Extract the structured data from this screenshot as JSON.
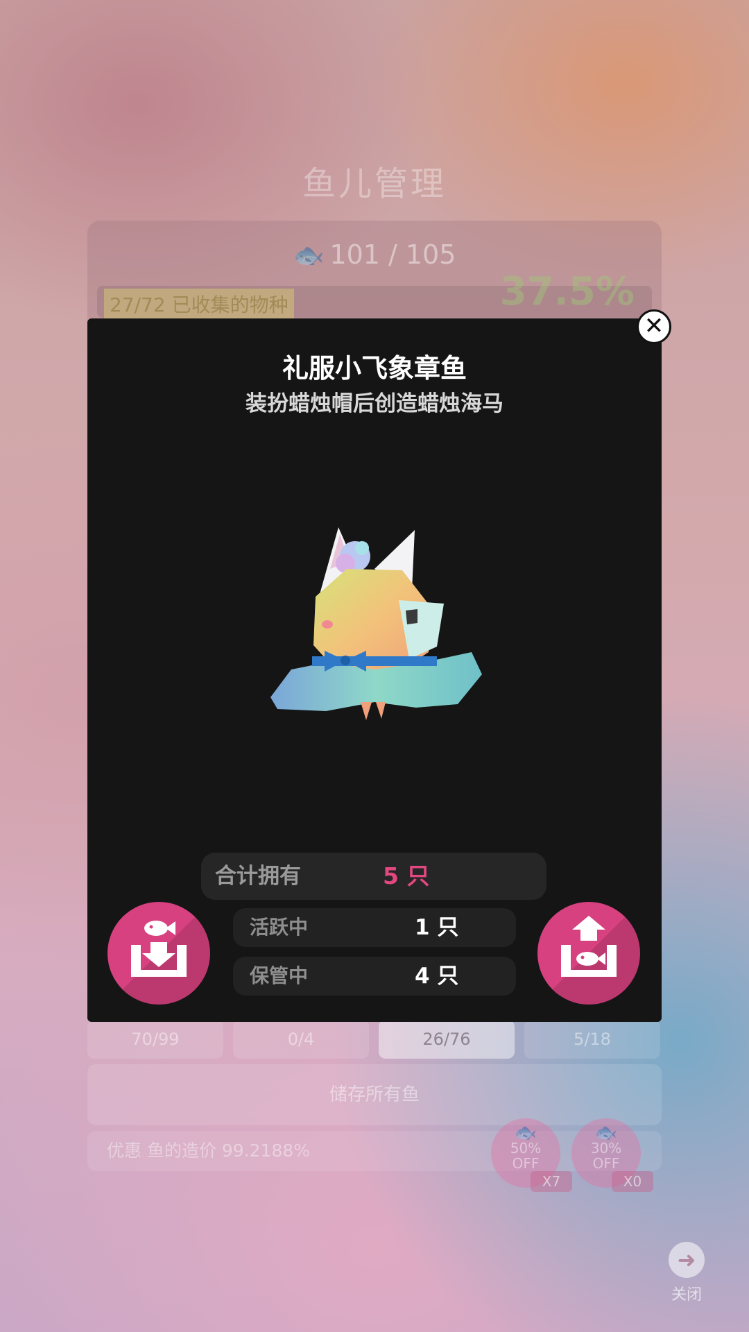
{
  "background": {
    "title": "鱼儿管理",
    "fish_count": "101 / 105",
    "species_collected": "27/72 已收集的物种",
    "percent": "37.5%",
    "tabs": [
      {
        "label": "70/99"
      },
      {
        "label": "0/4"
      },
      {
        "label": "26/76"
      },
      {
        "label": "5/18"
      }
    ],
    "store_all_label": "储存所有鱼",
    "discount_text": "优惠 鱼的造价 99.2188%",
    "badges": [
      {
        "label": "50%\nOFF",
        "count": "X7"
      },
      {
        "label": "30%\nOFF",
        "count": "X0"
      }
    ],
    "close_label": "关闭"
  },
  "modal": {
    "name": "礼服小飞象章鱼",
    "description": "装扮蜡烛帽后创造蜡烛海马",
    "stats": {
      "total_label": "合计拥有",
      "total_value": "5 只",
      "active_label": "活跃中",
      "active_value": "1 只",
      "stored_label": "保管中",
      "stored_value": "4 只"
    }
  },
  "colors": {
    "accent": "#d8417f",
    "total_value": "#e0487f",
    "modal_bg": "#151515"
  },
  "icons": {
    "close": "close-icon",
    "store": "store-fish-icon",
    "release": "release-fish-icon"
  }
}
